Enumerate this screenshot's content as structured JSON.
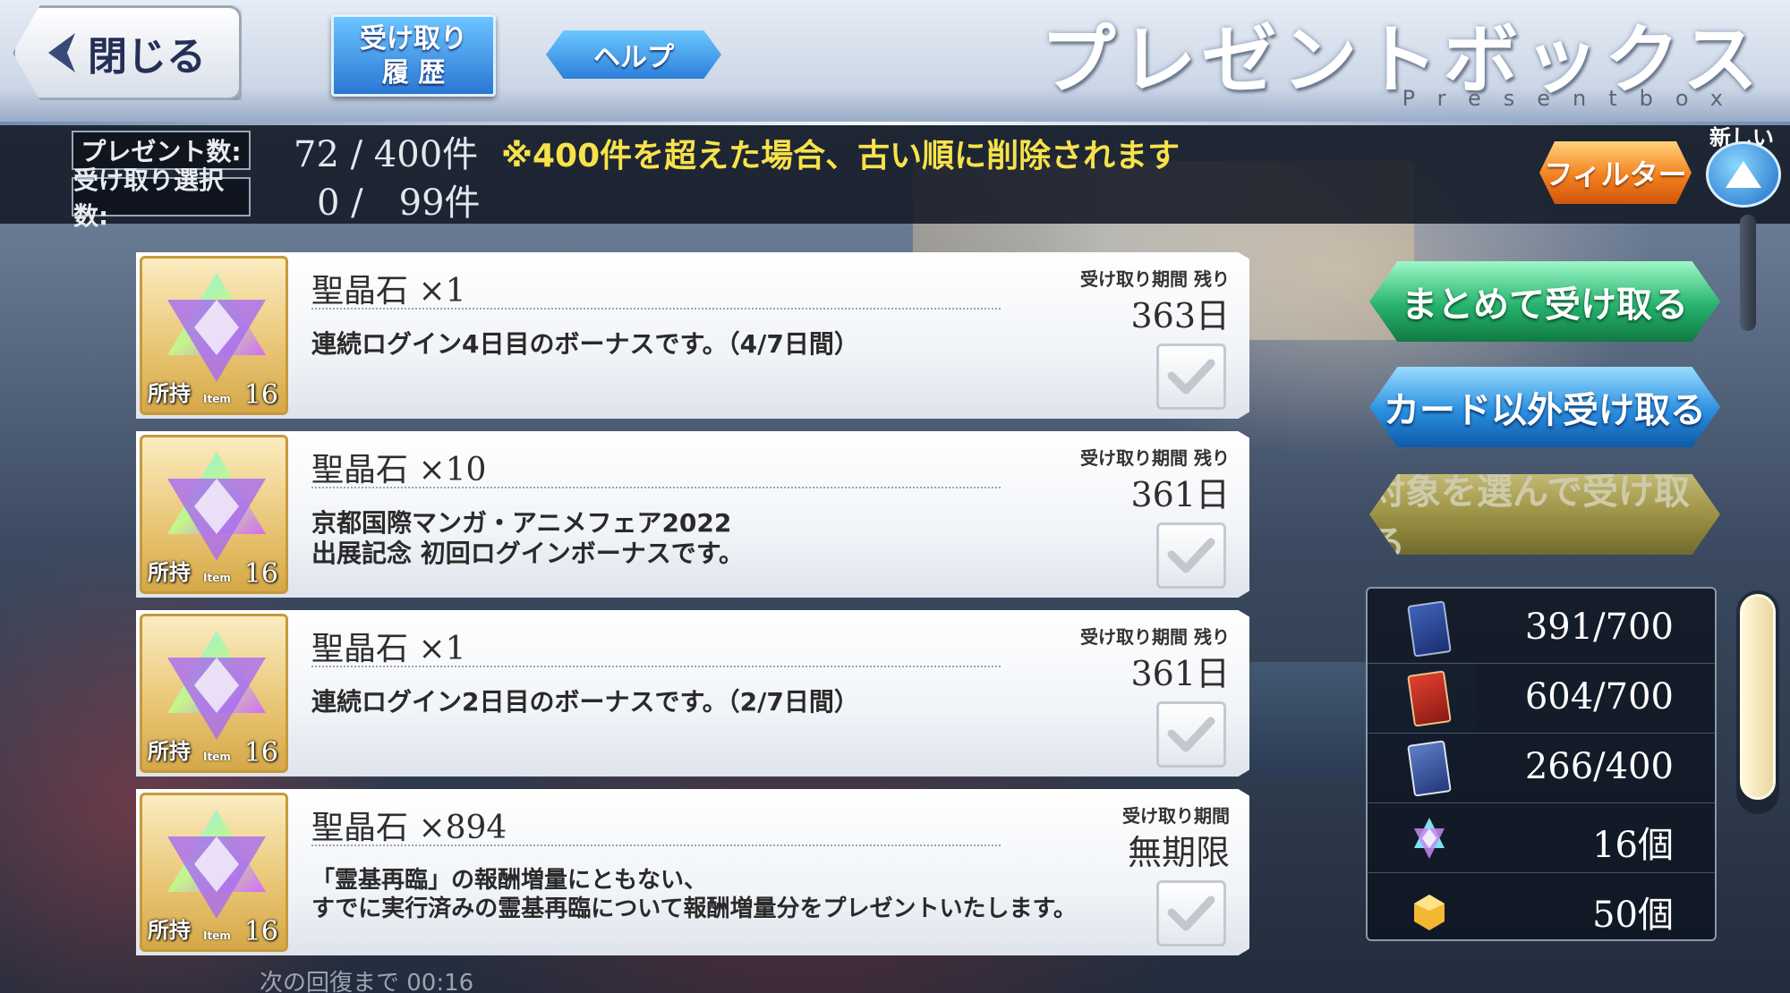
{
  "header": {
    "close_label": "閉じる",
    "history_label_line1": "受け取り",
    "history_label_line2": "履 歴",
    "help_label": "ヘルプ",
    "title": "プレゼントボックス",
    "subtitle": "Presentbox"
  },
  "info": {
    "present_count_label": "プレゼント数:",
    "present_count_value": "72 / 400件",
    "selected_count_label": "受け取り選択数:",
    "selected_count_value": "0 /　99件",
    "warning": "※400件を超えた場合、古い順に削除されます"
  },
  "controls": {
    "filter_label": "フィルター",
    "sort_label": "新しい順",
    "receive_all_label": "まとめて受け取る",
    "receive_non_card_label": "カード以外受け取る",
    "receive_selected_label": "対象を選んで受け取る"
  },
  "items": [
    {
      "name": "聖晶石 ×1",
      "description": "連続ログイン4日目のボーナスです。（4/7日間）",
      "period_label": "受け取り期間 残り",
      "period_value": "363日",
      "owned_label": "所持",
      "item_tag": "Item",
      "owned_count": "16"
    },
    {
      "name": "聖晶石 ×10",
      "description": "京都国際マンガ・アニメフェア2022\n出展記念 初回ログインボーナスです。",
      "period_label": "受け取り期間 残り",
      "period_value": "361日",
      "owned_label": "所持",
      "item_tag": "Item",
      "owned_count": "16"
    },
    {
      "name": "聖晶石 ×1",
      "description": "連続ログイン2日目のボーナスです。（2/7日間）",
      "period_label": "受け取り期間 残り",
      "period_value": "361日",
      "owned_label": "所持",
      "item_tag": "Item",
      "owned_count": "16"
    },
    {
      "name": "聖晶石 ×894",
      "description": "「霊基再臨」の報酬増量にともない、\nすでに実行済みの霊基再臨について報酬増量分をプレゼントいたします。",
      "period_label": "受け取り期間",
      "period_value": "無期限",
      "owned_label": "所持",
      "item_tag": "Item",
      "owned_count": "16"
    }
  ],
  "resources": [
    {
      "icon": "servant-card-icon",
      "value": "391/700"
    },
    {
      "icon": "craft-essence-card-icon",
      "value": "604/700"
    },
    {
      "icon": "command-code-card-icon",
      "value": "266/400"
    },
    {
      "icon": "saint-quartz-icon",
      "value": "16個"
    },
    {
      "icon": "gold-apple-icon",
      "value": "50個"
    }
  ],
  "footer": {
    "recovery_hint": "次の回復まで 00:16"
  },
  "colors": {
    "warning_yellow": "#f7e24a",
    "action_green": "#27b36d",
    "action_blue": "#2a8fe0",
    "filter_orange": "#f2811f"
  }
}
